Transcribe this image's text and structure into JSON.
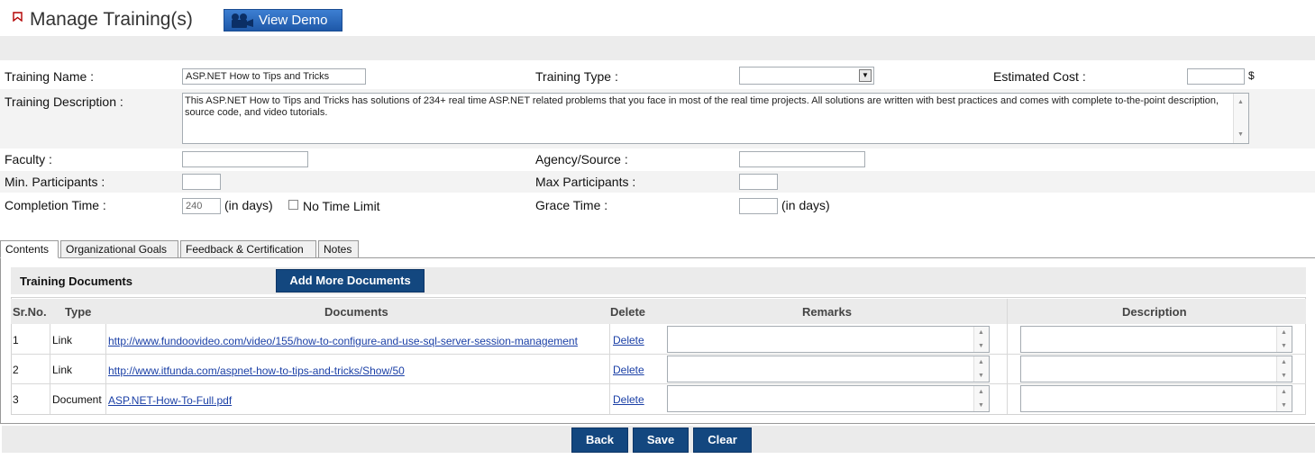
{
  "header": {
    "title": "Manage Training(s)",
    "demo_button": "View Demo"
  },
  "form": {
    "training_name_label": "Training Name :",
    "training_name_value": "ASP.NET How to Tips and Tricks",
    "training_type_label": "Training Type :",
    "training_type_value": "",
    "estimated_cost_label": "Estimated Cost  :",
    "estimated_cost_value": "",
    "currency_symbol": "$",
    "description_label": "Training Description  :",
    "description_value": "This ASP.NET How to Tips and Tricks has solutions of 234+ real time ASP.NET related problems that you face in most of the real time projects. All solutions are written with best practices and comes with complete to-the-point description, source code, and video tutorials.",
    "faculty_label": "Faculty  :",
    "faculty_value": "",
    "agency_label": "Agency/Source  :",
    "agency_value": "",
    "min_participants_label": "Min. Participants  :",
    "min_participants_value": "",
    "max_participants_label": "Max Participants  :",
    "max_participants_value": "",
    "completion_time_label": "Completion Time :",
    "completion_time_value": "240",
    "in_days": "(in days)",
    "no_time_limit_label": "No Time Limit",
    "grace_time_label": "Grace Time :",
    "grace_time_value": ""
  },
  "tabs": [
    "Contents",
    "Organizational Goals",
    "Feedback & Certification",
    "Notes"
  ],
  "documents": {
    "title": "Training Documents",
    "add_button": "Add More Documents",
    "columns": [
      "Sr.No.",
      "Type",
      "Documents",
      "Delete",
      "Remarks",
      "Description"
    ],
    "rows": [
      {
        "sr": "1",
        "type": "Link",
        "document": "http://www.fundoovideo.com/video/155/how-to-configure-and-use-sql-server-session-management",
        "delete": "Delete"
      },
      {
        "sr": "2",
        "type": "Link",
        "document": "http://www.itfunda.com/aspnet-how-to-tips-and-tricks/Show/50",
        "delete": "Delete"
      },
      {
        "sr": "3",
        "type": "Document",
        "document": "ASP.NET-How-To-Full.pdf",
        "delete": "Delete"
      }
    ]
  },
  "footer": {
    "back": "Back",
    "save": "Save",
    "clear": "Clear"
  }
}
